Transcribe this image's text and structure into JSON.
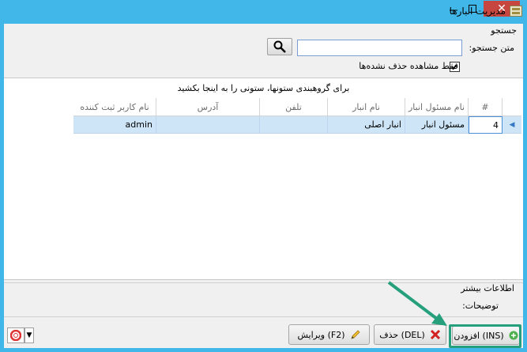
{
  "window": {
    "title": "مدیریت انبارها"
  },
  "search": {
    "group_label": "جستجو",
    "text_label": "متن جستجو:",
    "value": "",
    "checkbox_label": "فقط مشاهده حذف نشده‌ها",
    "checkbox_checked": true
  },
  "grid": {
    "group_hint": "برای گروهبندی ستونها، ستونی را به اینجا بکشید",
    "columns": [
      "#",
      "نام مسئول انبار",
      "نام انبار",
      "تلفن",
      "آدرس",
      "نام کاربر ثبت کننده"
    ],
    "rows": [
      {
        "num": "4",
        "manager": "مسئول انبار",
        "name": "انبار اصلی",
        "phone": "",
        "address": "",
        "user": "admin"
      }
    ]
  },
  "details": {
    "more_info_label": "اطلاعات بیشتر",
    "description_label": "توضیحات:"
  },
  "buttons": {
    "add_label": "(INS) افزودن",
    "delete_label": "(DEL) حذف",
    "edit_label": "(F2) ویرایش"
  },
  "colors": {
    "titlebar": "#41b7e9",
    "selected_row": "#cde5f7",
    "highlight": "#26a07c",
    "close": "#c7463f"
  }
}
